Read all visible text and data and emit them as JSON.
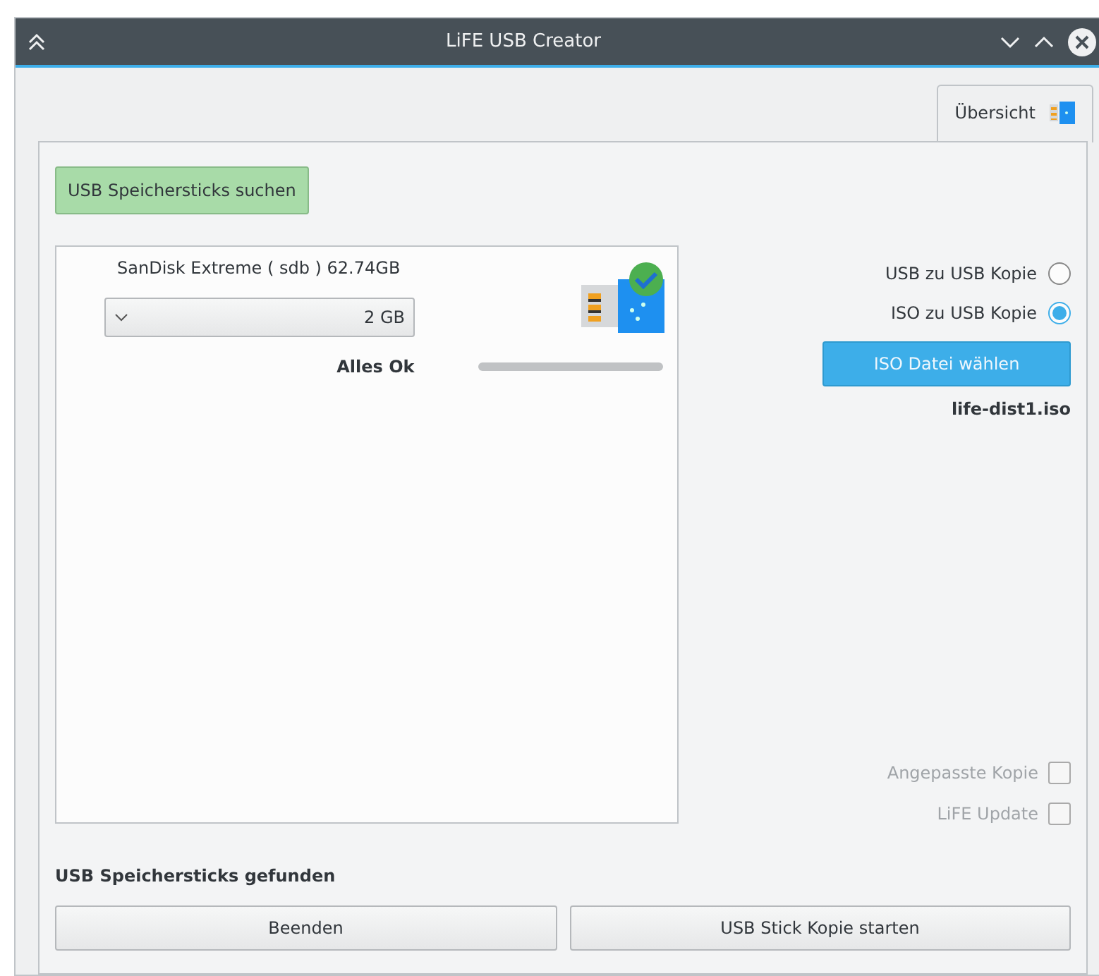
{
  "window": {
    "title": "LiFE USB Creator"
  },
  "tabs": [
    {
      "label": "Übersicht",
      "selected": true
    }
  ],
  "search_button": {
    "label": "USB Speichersticks suchen"
  },
  "devices": [
    {
      "name": "SanDisk Extreme ( sdb ) 62.74GB",
      "size": "2 GB",
      "status": "Alles Ok",
      "level": 0,
      "ok": true
    }
  ],
  "modes": [
    {
      "label": "USB zu USB Kopie",
      "selected": false
    },
    {
      "label": "ISO zu USB Kopie",
      "selected": true
    }
  ],
  "iso_button": {
    "label": "ISO Datei wählen"
  },
  "iso_file": "life-dist1.iso",
  "options": [
    {
      "label": "Angepasste Kopie",
      "checked": false,
      "disabled": true
    },
    {
      "label": "LiFE Update",
      "checked": false,
      "disabled": true
    }
  ],
  "status": "USB Speichersticks gefunden",
  "buttons": [
    {
      "label": "Beenden"
    },
    {
      "label": "USB Stick Kopie starten"
    }
  ]
}
